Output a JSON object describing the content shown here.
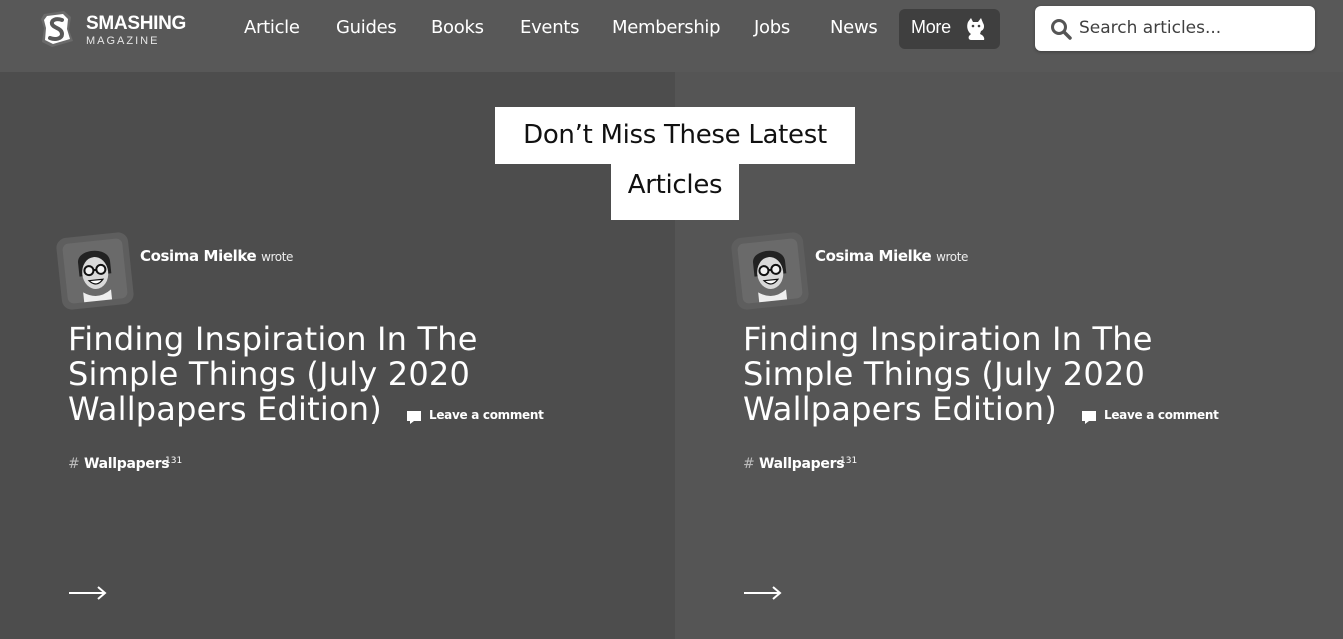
{
  "brand": {
    "name": "SMASHING",
    "sub": "MAGAZINE"
  },
  "nav": {
    "items": [
      "Article",
      "Guides",
      "Books",
      "Events",
      "Membership",
      "Jobs",
      "News"
    ],
    "more_label": "More"
  },
  "search": {
    "placeholder": "Search articles..."
  },
  "headline": {
    "line1": "Don’t Miss These Latest",
    "line2": "Articles"
  },
  "articles": [
    {
      "author": "Cosima Mielke",
      "wrote": "wrote",
      "title": "Finding Inspiration In The Simple Things (July 2020 Wallpapers Edition)",
      "comment_label": "Leave a comment",
      "tag_hash": "#",
      "tag": "Wallpapers",
      "tag_count": "131",
      "arrow": "⟶"
    },
    {
      "author": "Cosima Mielke",
      "wrote": "wrote",
      "title": "Finding Inspiration In The Simple Things (July 2020 Wallpapers Edition)",
      "comment_label": "Leave a comment",
      "tag_hash": "#",
      "tag": "Wallpapers",
      "tag_count": "131",
      "arrow": "⟶"
    }
  ],
  "colors": {
    "header_bg": "#585858",
    "panel_left_bg": "#4d4d4d",
    "panel_right_bg": "#555555",
    "more_bg": "#3f3f3f",
    "text": "#ffffff"
  },
  "icons": {
    "logo": "smashing-s-logo",
    "more": "cat-icon",
    "search": "search-icon",
    "comment": "comment-icon",
    "avatar": "author-avatar"
  }
}
